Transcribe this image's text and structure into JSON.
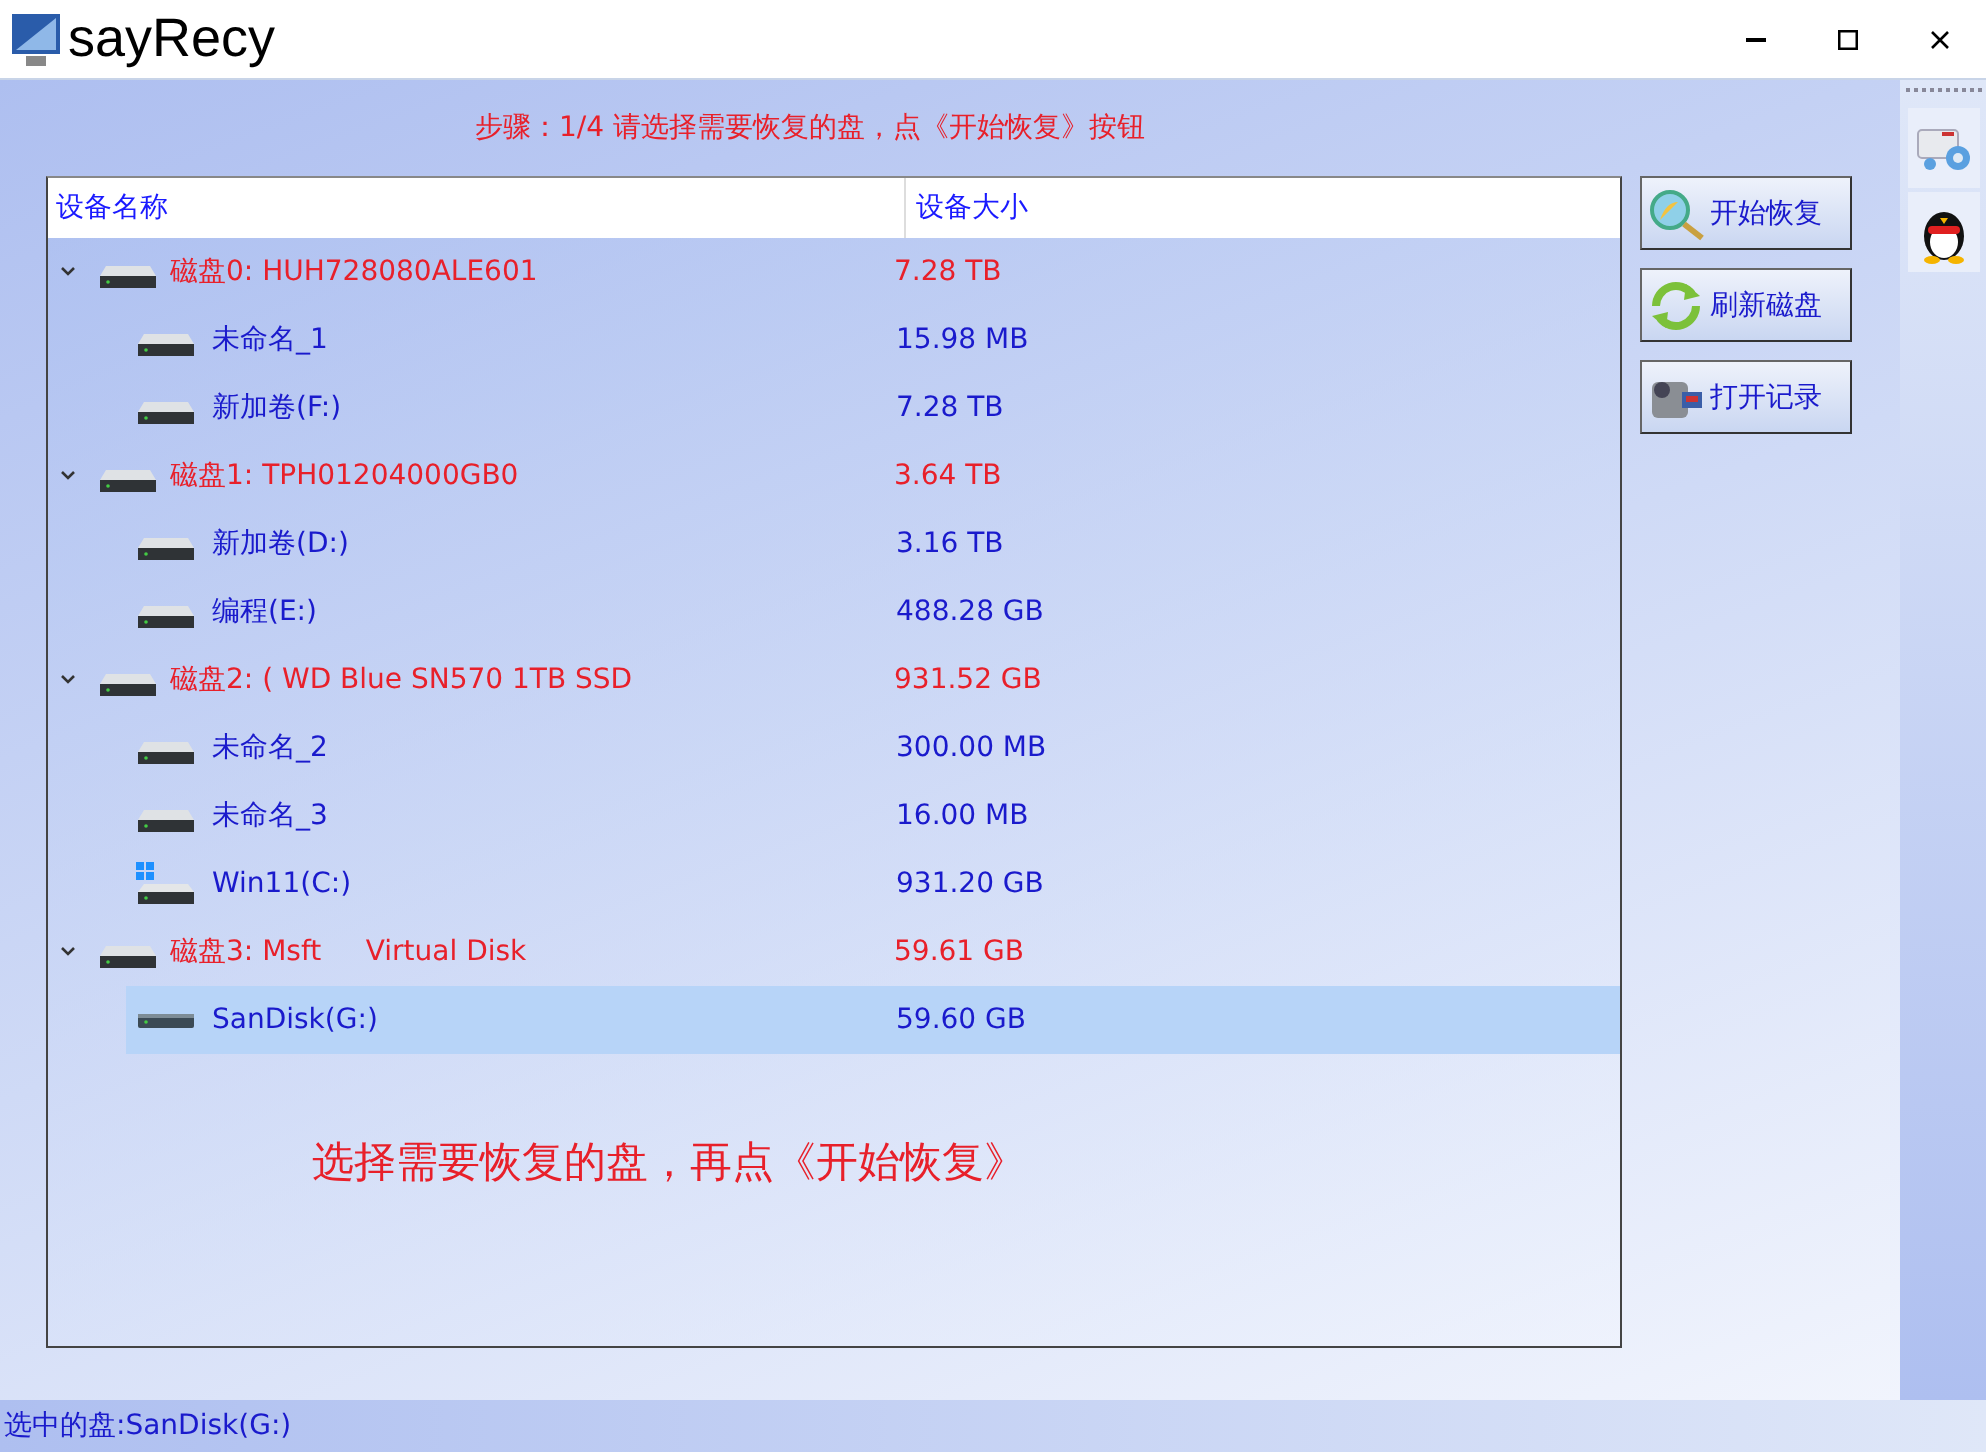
{
  "window": {
    "title": "sayRecy"
  },
  "step_text": "步骤：1/4 请选择需要恢复的盘，点《开始恢复》按钮",
  "table": {
    "columns": [
      "设备名称",
      "设备大小"
    ],
    "disks": [
      {
        "name": "磁盘0: HUH728080ALE601",
        "size": "7.28 TB",
        "expanded": true,
        "children": [
          {
            "name": "未命名_1",
            "size": "15.98 MB",
            "kind": "drive",
            "selected": false
          },
          {
            "name": "新加卷(F:)",
            "size": "7.28 TB",
            "kind": "drive",
            "selected": false
          }
        ]
      },
      {
        "name": "磁盘1: TPH01204000GB0",
        "size": "3.64 TB",
        "expanded": true,
        "children": [
          {
            "name": "新加卷(D:)",
            "size": "3.16 TB",
            "kind": "drive",
            "selected": false
          },
          {
            "name": "编程(E:)",
            "size": "488.28 GB",
            "kind": "drive",
            "selected": false
          }
        ]
      },
      {
        "name": "磁盘2: ( WD Blue SN570 1TB SSD",
        "size": "931.52 GB",
        "expanded": true,
        "children": [
          {
            "name": "未命名_2",
            "size": "300.00 MB",
            "kind": "drive",
            "selected": false
          },
          {
            "name": "未命名_3",
            "size": "16.00 MB",
            "kind": "drive",
            "selected": false
          },
          {
            "name": "Win11(C:)",
            "size": "931.20 GB",
            "kind": "windows",
            "selected": false
          }
        ]
      },
      {
        "name": "磁盘3: Msft     Virtual Disk",
        "size": "59.61 GB",
        "expanded": true,
        "children": [
          {
            "name": "SanDisk(G:)",
            "size": "59.60 GB",
            "kind": "usb",
            "selected": true
          }
        ]
      }
    ],
    "hint": "选择需要恢复的盘，再点《开始恢复》"
  },
  "buttons": [
    {
      "label": "开始恢复",
      "kind": "search"
    },
    {
      "label": "刷新磁盘",
      "kind": "refresh"
    },
    {
      "label": "打开记录",
      "kind": "camera"
    }
  ],
  "side_tools": [
    {
      "kind": "computer"
    },
    {
      "kind": "penguin"
    }
  ],
  "status_bar": "选中的盘:SanDisk(G:)"
}
